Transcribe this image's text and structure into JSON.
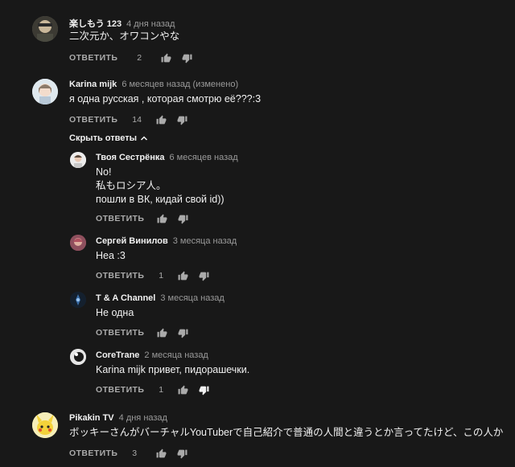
{
  "actions": {
    "reply_label": "ОТВЕТИТЬ"
  },
  "toggle": {
    "label": "Скрыть ответы"
  },
  "comments": [
    {
      "author": "楽しもう 123",
      "time": "4 дня назад",
      "text": [
        "二次元か、オワコンやな"
      ],
      "likes": "2"
    },
    {
      "author": "Karina mijk",
      "time": "6 месяцев назад (изменено)",
      "text": [
        "я одна русская , которая смотрю её???:3"
      ],
      "likes": "14"
    },
    {
      "author": "Pikakin TV",
      "time": "4 дня назад",
      "text": [
        "ボッキーさんがバーチャルYouTuberで自己紹介で普通の人間と違うとか言ってたけど、この人か"
      ],
      "likes": "3"
    }
  ],
  "replies": [
    {
      "author": "Твоя Сестрёнка",
      "time": "6 месяцев назад",
      "text": [
        "No!",
        "私もロシア人。",
        "пошли в ВК, кидай свой id))"
      ],
      "likes": ""
    },
    {
      "author": "Сергей Винилов",
      "time": "3 месяца назад",
      "text": [
        "Неа :3"
      ],
      "likes": "1"
    },
    {
      "author": "T & A Channel",
      "time": "3 месяца назад",
      "text": [
        "Не одна"
      ],
      "likes": ""
    },
    {
      "author": "CoreTrane",
      "time": "2 месяца назад",
      "text": [
        "Karina mijk привет, пидорашечки."
      ],
      "likes": "1"
    }
  ],
  "colors": {
    "background": "#181818",
    "disliked": "#f1f1f1"
  }
}
